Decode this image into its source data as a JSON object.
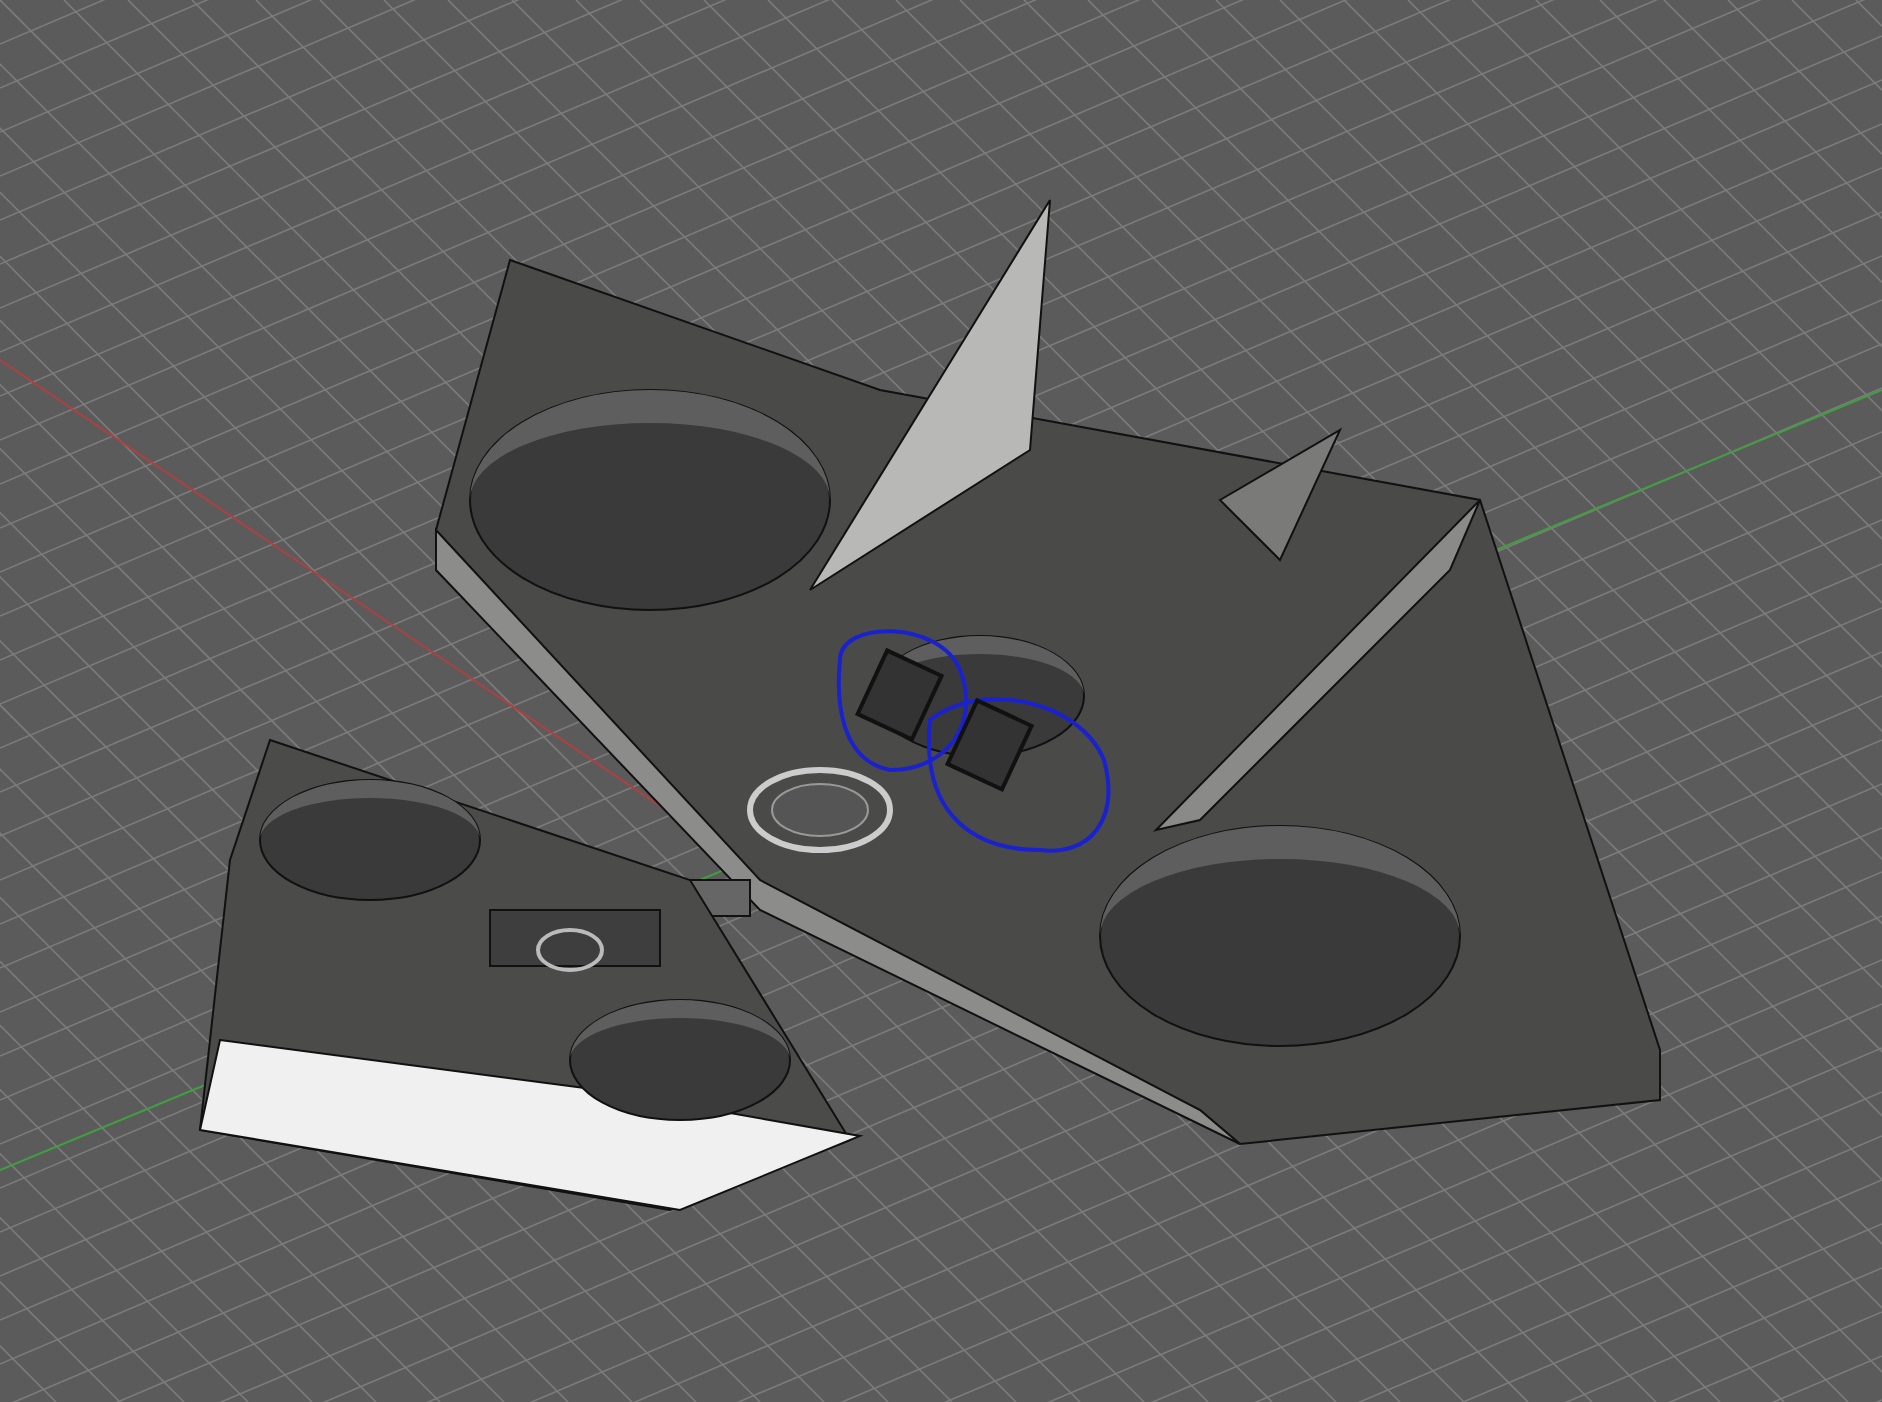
{
  "viewport": {
    "parts": [
      {
        "kind": "main-body"
      },
      {
        "kind": "side-piece"
      }
    ],
    "sketch_visible": true
  }
}
